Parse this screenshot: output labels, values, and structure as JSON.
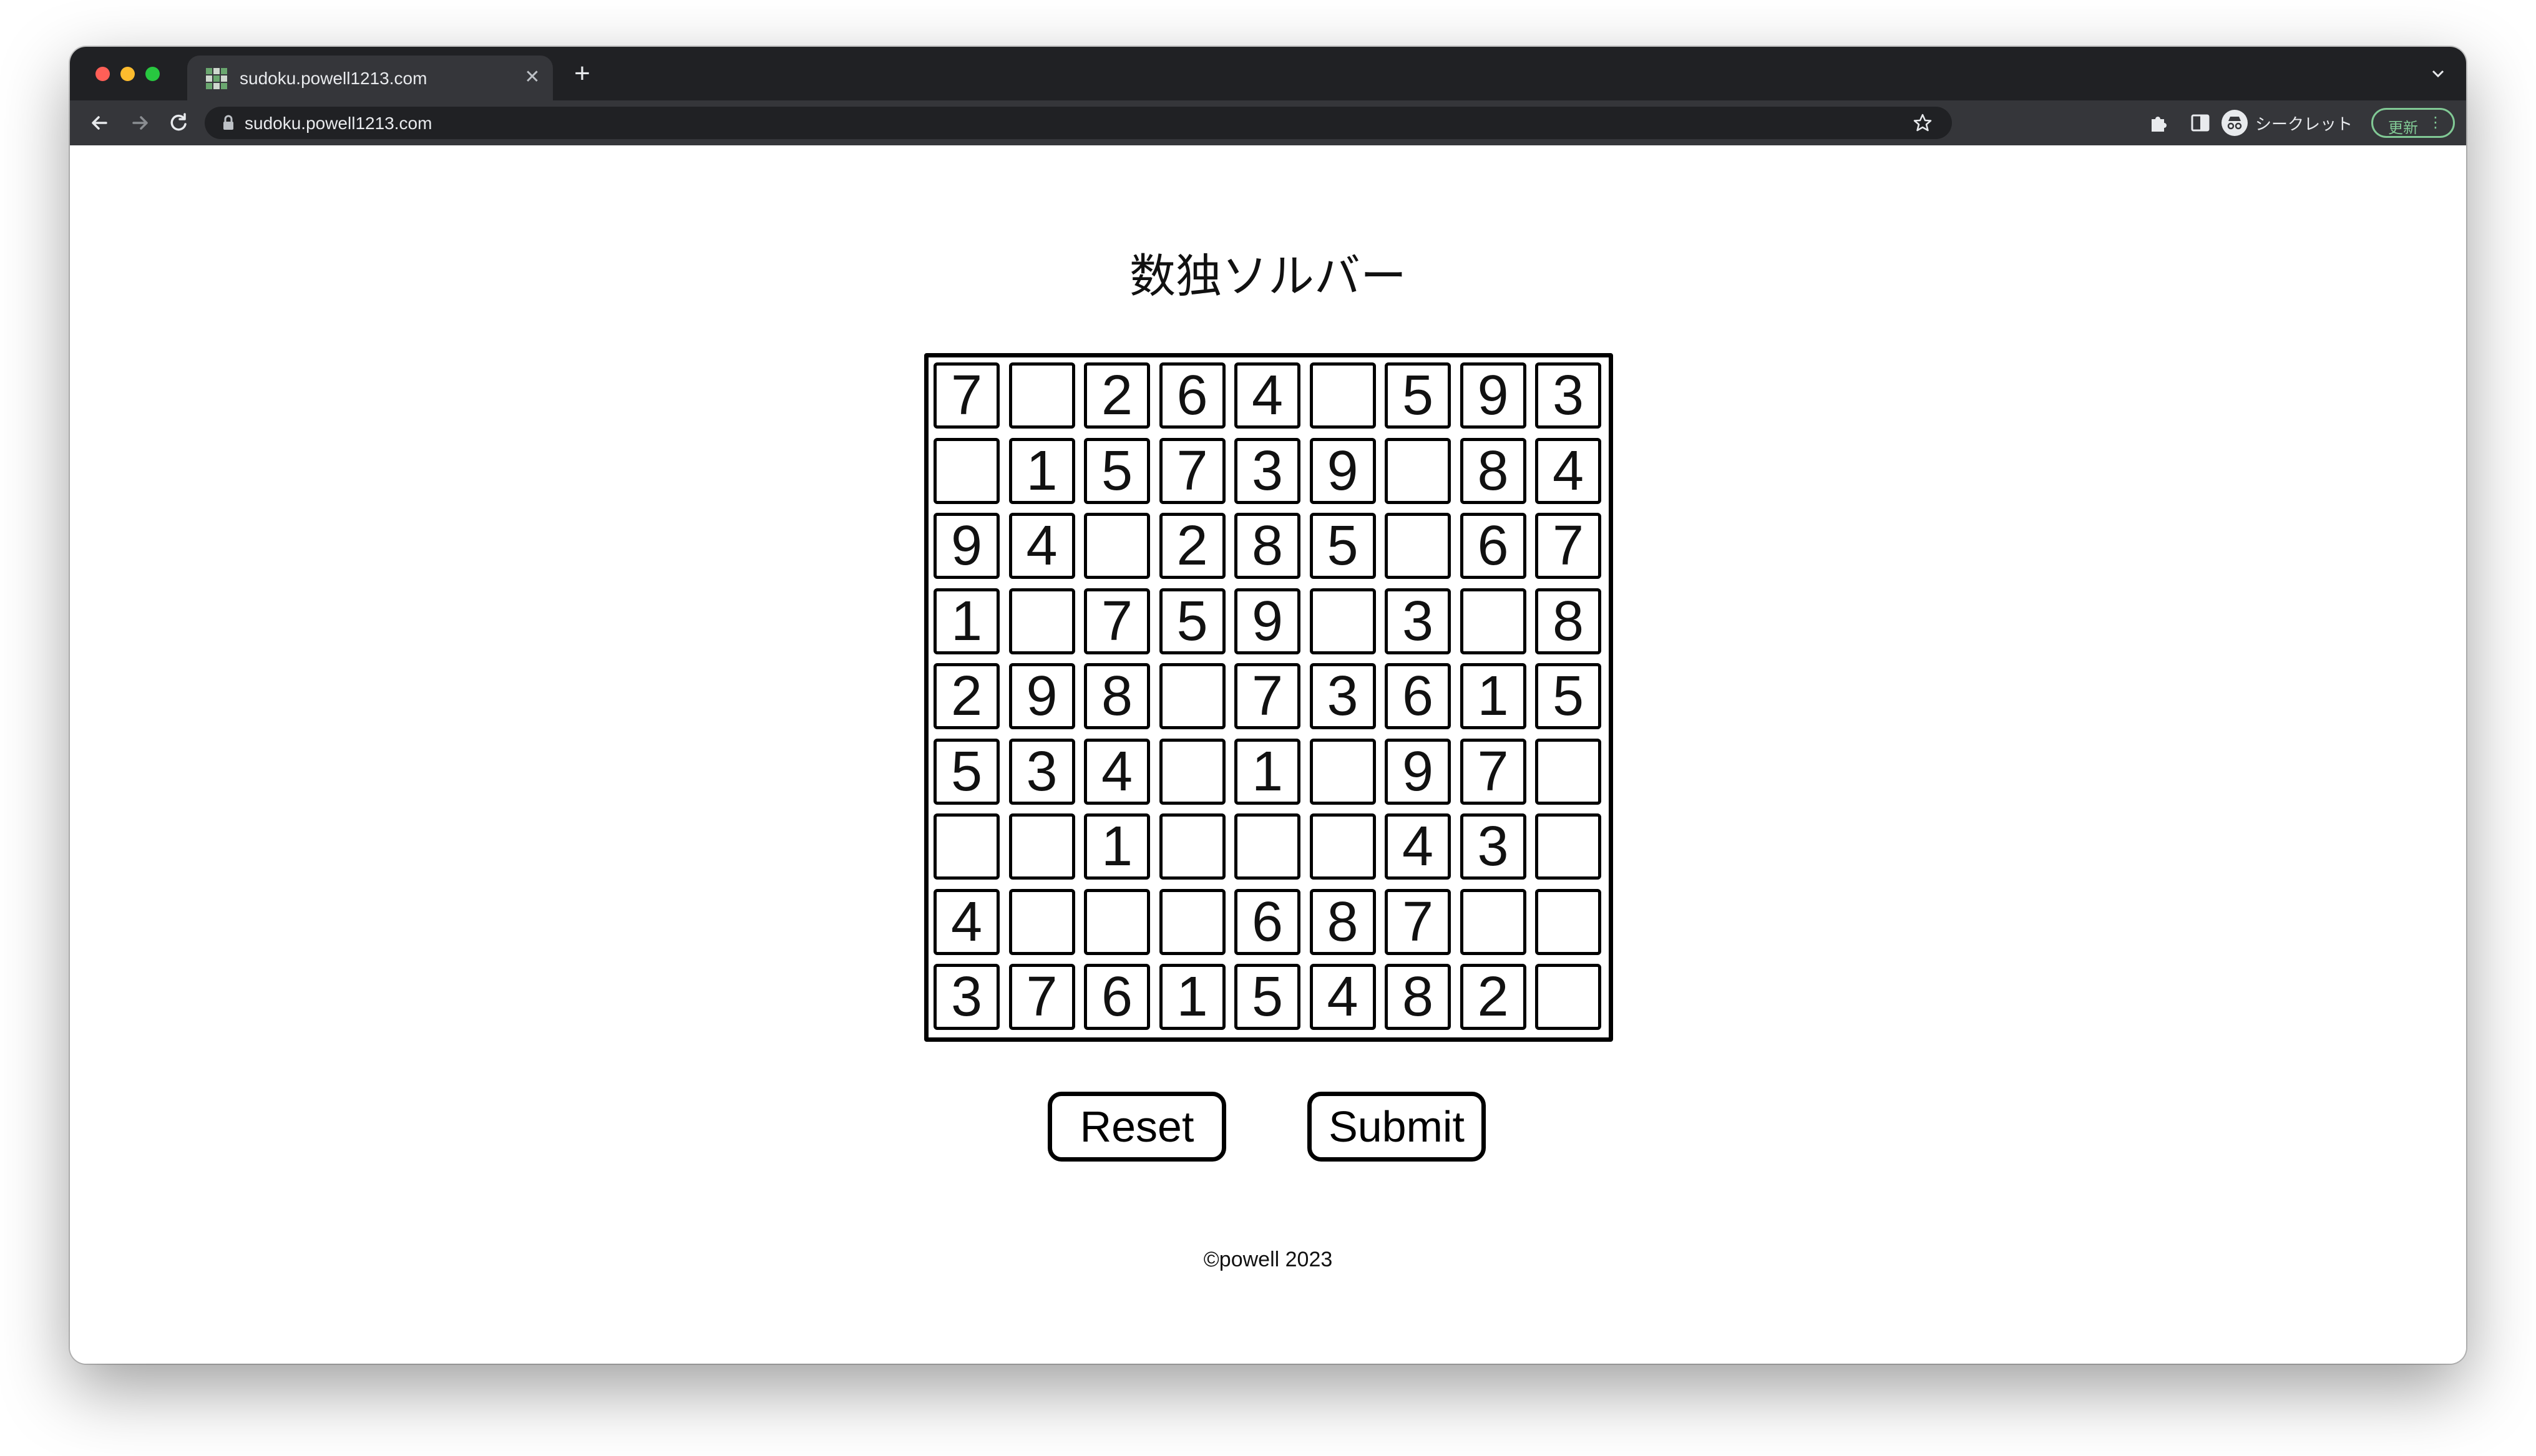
{
  "browser": {
    "tab_title": "sudoku.powell1213.com",
    "url": "sudoku.powell1213.com",
    "profile_label": "シークレット",
    "update_label": "更新"
  },
  "page": {
    "title": "数独ソルバー",
    "grid": [
      [
        "7",
        "",
        "2",
        "6",
        "4",
        "",
        "5",
        "9",
        "3"
      ],
      [
        "",
        "1",
        "5",
        "7",
        "3",
        "9",
        "",
        "8",
        "4"
      ],
      [
        "9",
        "4",
        "",
        "2",
        "8",
        "5",
        "",
        "6",
        "7"
      ],
      [
        "1",
        "",
        "7",
        "5",
        "9",
        "",
        "3",
        "",
        "8"
      ],
      [
        "2",
        "9",
        "8",
        "",
        "7",
        "3",
        "6",
        "1",
        "5"
      ],
      [
        "5",
        "3",
        "4",
        "",
        "1",
        "",
        "9",
        "7",
        ""
      ],
      [
        "",
        "",
        "1",
        "",
        "",
        "",
        "4",
        "3",
        ""
      ],
      [
        "4",
        "",
        "",
        "",
        "6",
        "8",
        "7",
        "",
        ""
      ],
      [
        "3",
        "7",
        "6",
        "1",
        "5",
        "4",
        "8",
        "2",
        ""
      ]
    ],
    "reset_label": "Reset",
    "submit_label": "Submit",
    "footer": "©powell 2023"
  }
}
